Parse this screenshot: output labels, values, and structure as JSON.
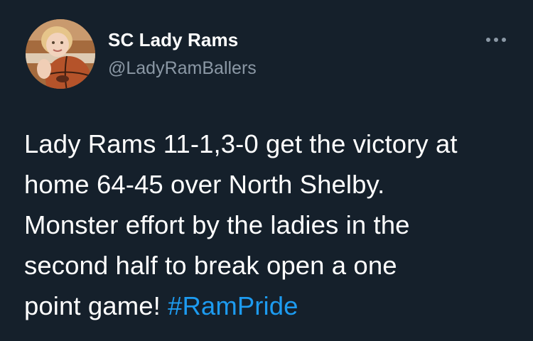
{
  "author": {
    "display_name": "SC Lady Rams",
    "handle": "@LadyRamBallers",
    "avatar_icon": "avatar-photo-child-with-basketball"
  },
  "actions": {
    "more_icon": "more-horizontal-icon"
  },
  "tweet": {
    "lines": [
      "Lady Rams 11-1,3-0 get the victory at",
      "home 64-45 over North Shelby.",
      "Monster effort by the ladies in the",
      "second half to break open a one",
      "point game! "
    ],
    "hashtag": "#RamPride"
  },
  "colors": {
    "background": "#15202b",
    "text": "#ffffff",
    "secondary_text": "#8b98a5",
    "link": "#1d9bf0"
  }
}
